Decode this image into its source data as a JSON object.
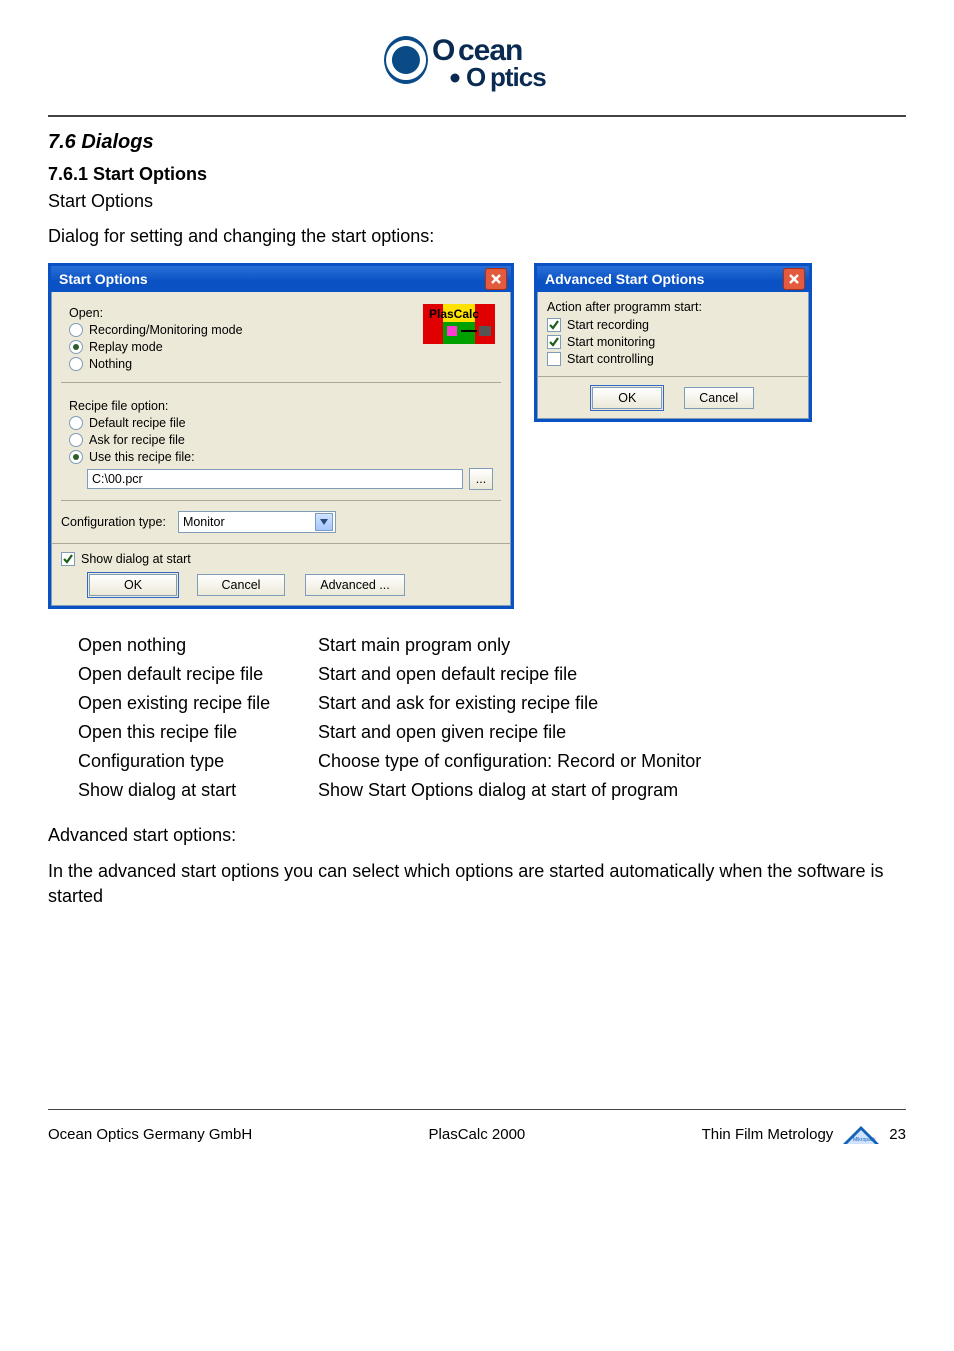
{
  "logo": {
    "brand_top": "cean",
    "brand_bottom": "ptics"
  },
  "section": {
    "num_title": "7.6   Dialogs"
  },
  "subsection": {
    "num_title": "7.6.1 Start Options"
  },
  "intro": {
    "line1": "Start Options",
    "line2": "Dialog for setting and changing the start options:"
  },
  "start_dialog": {
    "title": "Start Options",
    "open_label": "Open:",
    "open_options": {
      "recording": "Recording/Monitoring mode",
      "replay": "Replay mode",
      "nothing": "Nothing"
    },
    "recipe_label": "Recipe file option:",
    "recipe_options": {
      "default": "Default recipe file",
      "ask": "Ask for recipe file",
      "use_this": "Use this recipe file:"
    },
    "recipe_path": "C:\\00.pcr",
    "browse_btn": "...",
    "config_label": "Configuration type:",
    "config_value": "Monitor",
    "show_dialog_label": "Show dialog at start",
    "buttons": {
      "ok": "OK",
      "cancel": "Cancel",
      "advanced": "Advanced ..."
    },
    "badge_text": "PlasCalc"
  },
  "adv_dialog": {
    "title": "Advanced Start Options",
    "heading": "Action after programm start:",
    "options": {
      "start_recording": "Start recording",
      "start_monitoring": "Start monitoring",
      "start_controlling": "Start controlling"
    },
    "buttons": {
      "ok": "OK",
      "cancel": "Cancel"
    }
  },
  "definitions": [
    {
      "term": "Open nothing",
      "desc": "Start main program only"
    },
    {
      "term": "Open default recipe file",
      "desc": "Start and open default recipe file"
    },
    {
      "term": "Open existing recipe file",
      "desc": "Start and ask for existing recipe file"
    },
    {
      "term": "Open this recipe file",
      "desc": "Start and open given recipe file"
    },
    {
      "term": "Configuration type",
      "desc": "Choose type of configuration: Record or Monitor"
    },
    {
      "term": "Show dialog at start",
      "desc": "Show Start Options dialog at start of program"
    }
  ],
  "adv_text": {
    "heading": "Advanced start options:",
    "body": "In the advanced start options you can select which options are started automatically when the software is started"
  },
  "footer": {
    "left": "Ocean Optics Germany GmbH",
    "center": "PlasCalc 2000",
    "right_label": "Thin Film Metrology",
    "page": "23"
  }
}
